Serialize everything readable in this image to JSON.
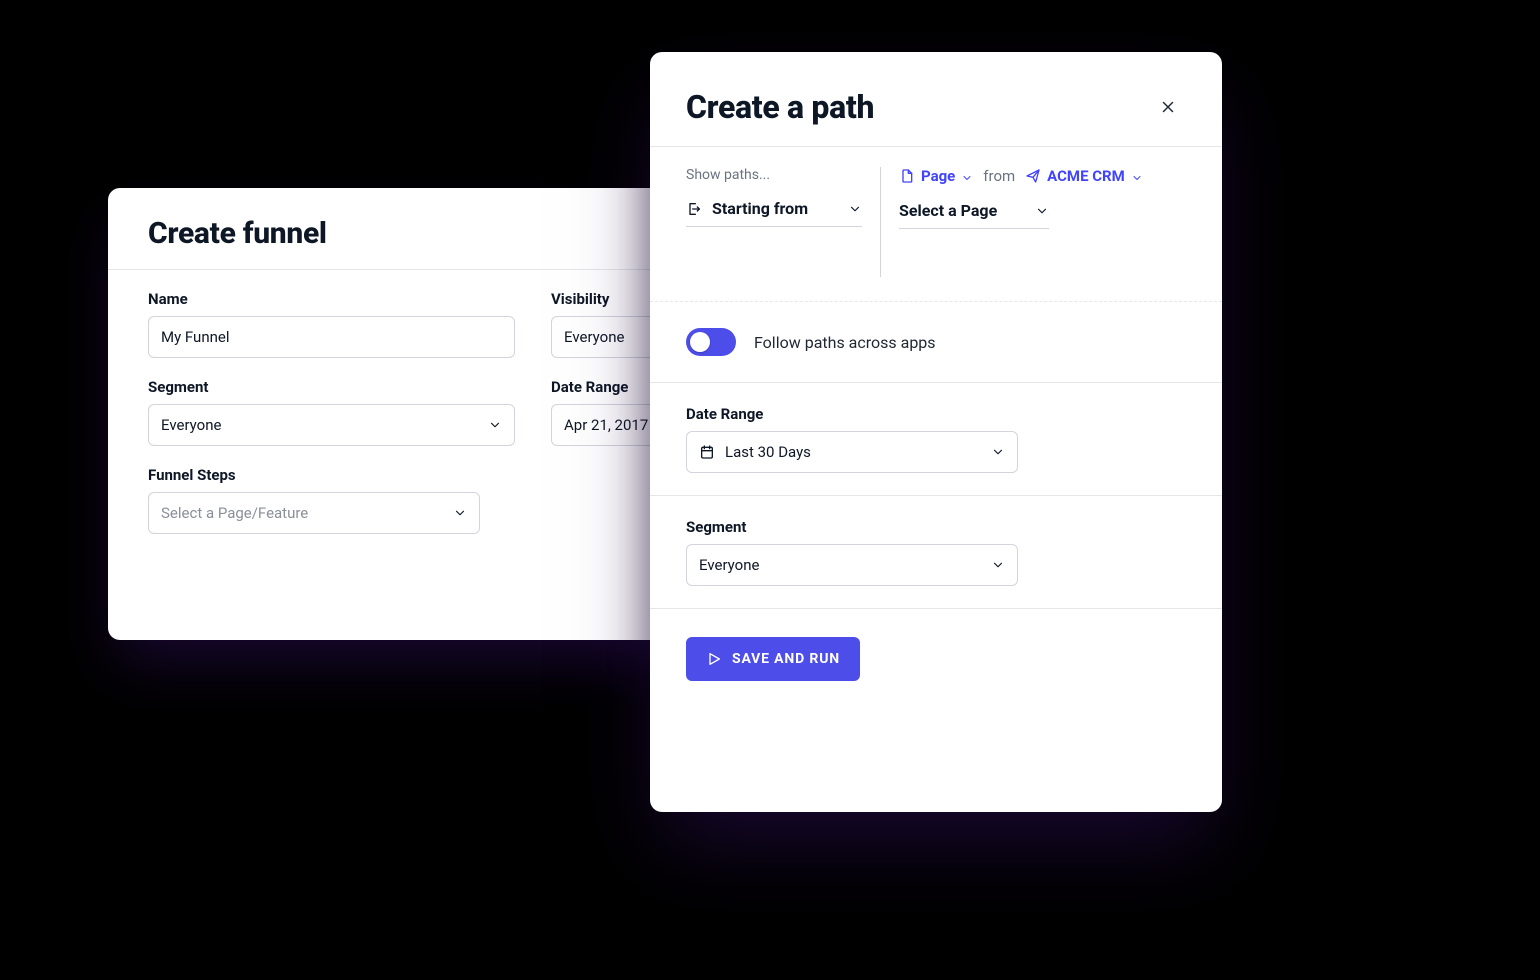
{
  "funnel": {
    "title": "Create funnel",
    "name": {
      "label": "Name",
      "value": "My Funnel"
    },
    "visibility": {
      "label": "Visibility",
      "value": "Everyone"
    },
    "segment": {
      "label": "Segment",
      "value": "Everyone"
    },
    "dateRange": {
      "label": "Date Range",
      "value": "Apr 21, 2017 -"
    },
    "funnelSteps": {
      "label": "Funnel Steps",
      "placeholder": "Select a Page/Feature"
    }
  },
  "path": {
    "title": "Create a path",
    "showPathsLabel": "Show paths...",
    "direction": "Starting from",
    "typeLabel": "Page",
    "fromLabel": "from",
    "appLabel": "ACME CRM",
    "selectPage": "Select a Page",
    "follow": {
      "label": "Follow paths across apps",
      "on": true
    },
    "dateRange": {
      "label": "Date Range",
      "value": "Last 30 Days"
    },
    "segment": {
      "label": "Segment",
      "value": "Everyone"
    },
    "saveRun": "Save and Run"
  }
}
